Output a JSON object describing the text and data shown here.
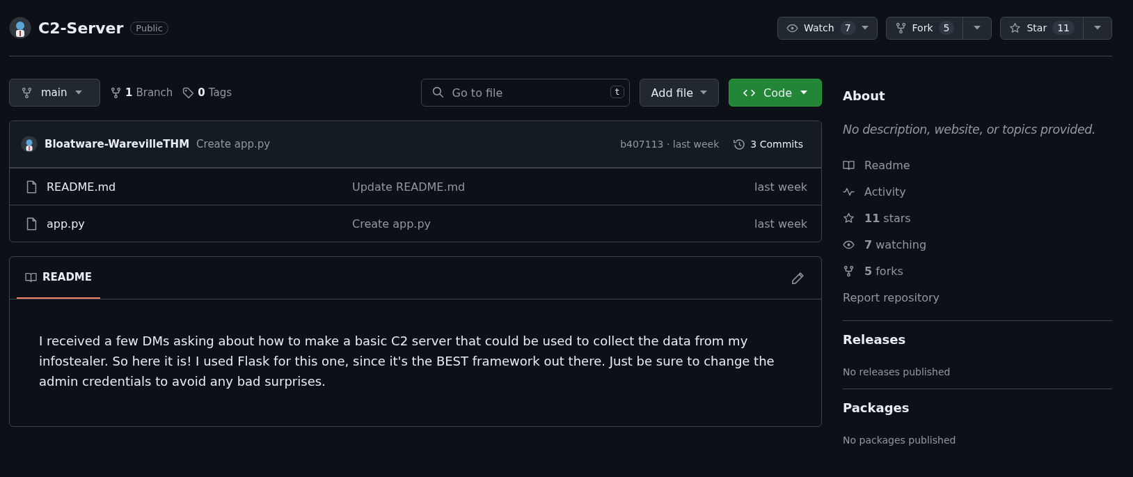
{
  "repo": {
    "name": "C2-Server",
    "visibility": "Public"
  },
  "actions": [
    {
      "kind": "eye",
      "label": "Watch",
      "count": "7",
      "split": false
    },
    {
      "kind": "fork",
      "label": "Fork",
      "count": "5",
      "split": true
    },
    {
      "kind": "star",
      "label": "Star",
      "count": "11",
      "split": true
    }
  ],
  "toolbar": {
    "branch": "main",
    "branches": {
      "count": "1",
      "label": "Branch"
    },
    "tags": {
      "count": "0",
      "label": "Tags"
    },
    "search": {
      "placeholder": "Go to file",
      "shortcut": "t"
    },
    "add_file": "Add file",
    "code": "Code"
  },
  "commit": {
    "author": "Bloatware-WarevilleTHM",
    "message": "Create app.py",
    "hash": "b407113 · last week",
    "commits": "3 Commits"
  },
  "files": [
    {
      "name": "README.md",
      "message": "Update README.md",
      "time": "last week"
    },
    {
      "name": "app.py",
      "message": "Create app.py",
      "time": "last week"
    }
  ],
  "readme": {
    "tabs": [
      {
        "label": "README",
        "selected": true
      }
    ],
    "text": "I received a few DMs asking about how to make a basic C2 server that could be used to collect the data from my infostealer. So here it is! I used Flask for this one, since it's the BEST framework out there. Just be sure to change the admin credentials to avoid any bad surprises."
  },
  "about": {
    "title": "About",
    "description": "No description, website, or topics provided.",
    "items": [
      {
        "kind": "book",
        "label": "Readme"
      },
      {
        "kind": "pulse",
        "label": "Activity"
      },
      {
        "kind": "star",
        "count": "11",
        "label": "stars"
      },
      {
        "kind": "eye",
        "count": "7",
        "label": "watching"
      },
      {
        "kind": "fork",
        "count": "5",
        "label": "forks"
      }
    ],
    "report": "Report repository"
  },
  "releases": {
    "title": "Releases",
    "text": "No releases published"
  },
  "packages": {
    "title": "Packages",
    "text": "No packages published"
  }
}
